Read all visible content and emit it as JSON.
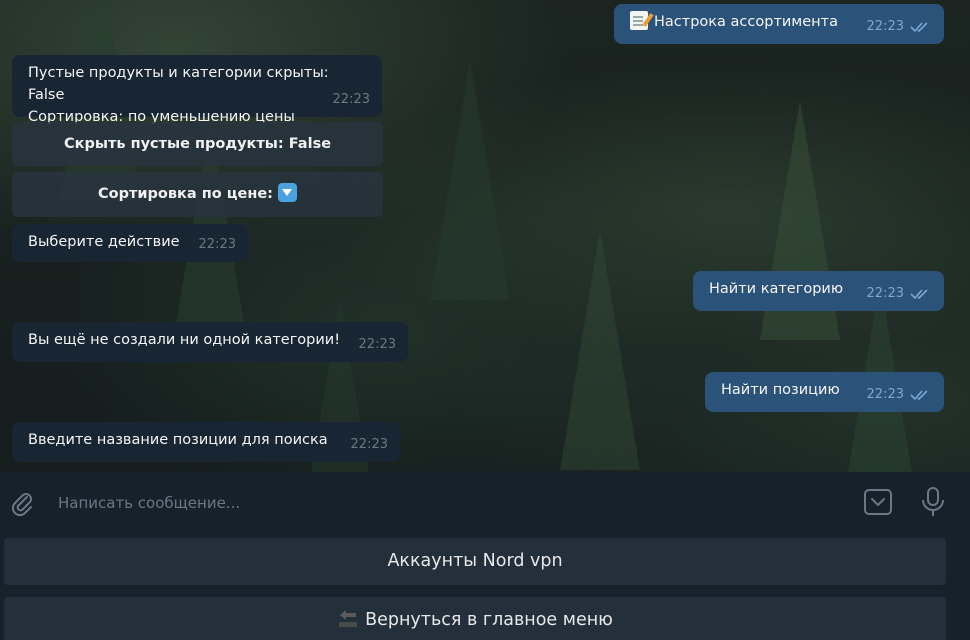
{
  "messages": [
    {
      "dir": "out",
      "icon": "note-icon",
      "text": "Настрока ассортимента",
      "time": "22:23"
    },
    {
      "dir": "in",
      "text": "Пустые продукты и категории скрыты: False\nСортировка: по уменьшению цены",
      "time": "22:23"
    },
    {
      "dir": "in",
      "text": "Выберите действие",
      "time": "22:23"
    },
    {
      "dir": "out",
      "text": "Найти категорию",
      "time": "22:23"
    },
    {
      "dir": "in",
      "text": "Вы ещё не создали ни одной категории!",
      "time": "22:23"
    },
    {
      "dir": "out",
      "text": "Найти позицию",
      "time": "22:23"
    },
    {
      "dir": "in",
      "text": "Введите название позиции для поиска",
      "time": "22:23"
    }
  ],
  "inline_buttons": [
    {
      "label": "Скрыть пустые продукты: False"
    },
    {
      "label": "Сортировка по цене:",
      "icon": "down-arrow-emoji-icon"
    }
  ],
  "composer": {
    "placeholder": "Написать сообщение..."
  },
  "keyboard": [
    {
      "label": "Аккаунты Nord vpn"
    },
    {
      "label": "Вернуться в главное меню",
      "icon": "back-arrow-icon"
    }
  ],
  "colors": {
    "outgoing_bubble": "#2b5278",
    "incoming_bubble": "#182533",
    "panel": "#17212b",
    "keyboard_button": "#232f3b",
    "read_checks": "#7da8d3"
  }
}
